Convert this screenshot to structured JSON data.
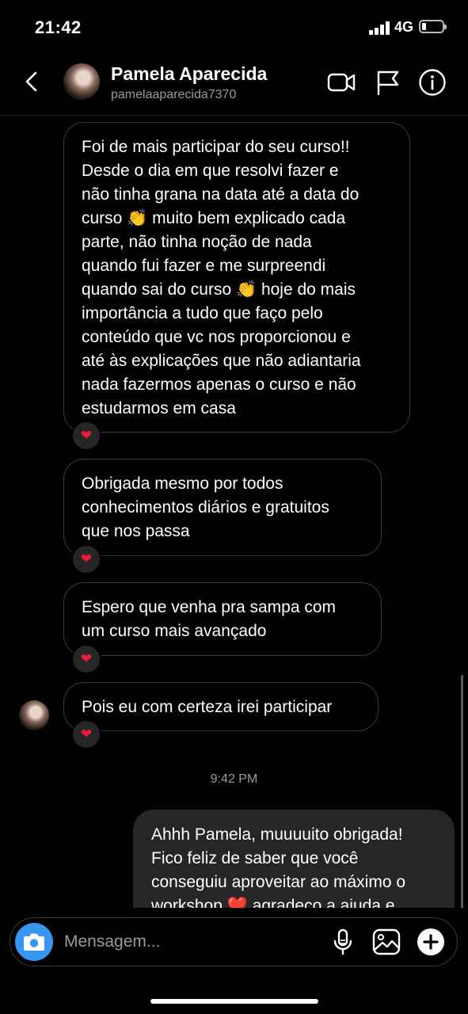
{
  "status_bar": {
    "time": "21:42",
    "network": "4G"
  },
  "header": {
    "name": "Pamela Aparecida",
    "username": "pamelaaparecida7370"
  },
  "messages": [
    {
      "text": "Foi de mais participar do seu curso!!\nDesde o dia em que resolvi fazer e\nnão tinha grana na data até a data do\ncurso 👏 muito bem explicado cada\nparte, não tinha noção de nada\nquando fui fazer e me surpreendi\nquando sai do curso 👏 hoje do mais\nimportância a tudo que faço pelo\nconteúdo que vc nos proporcionou e\naté às explicações que não adiantaria\nnada fazermos apenas o curso e não\nestudarmos em casa",
      "reaction": "❤"
    },
    {
      "text": "Obrigada mesmo por todos\nconhecimentos diários e gratuitos\nque nos passa",
      "reaction": "❤"
    },
    {
      "text": "Espero que venha pra sampa com\num curso mais avançado",
      "reaction": "❤"
    },
    {
      "text": "Pois eu com certeza irei participar",
      "reaction": "❤"
    },
    {
      "text": "Ahhh Pamela, muuuuito obrigada!\nFico feliz de saber que você\nconseguiu aproveitar ao máximo o\nworkshop ❤️ agradeço a ajuda e"
    }
  ],
  "timestamp": "9:42 PM",
  "composer": {
    "placeholder": "Mensagem..."
  },
  "icons": [
    "back-icon",
    "video-call-icon",
    "flag-icon",
    "info-icon",
    "camera-icon",
    "microphone-icon",
    "gallery-icon",
    "add-icon"
  ],
  "colors": {
    "background": "#000000",
    "camera_button": "#3797f0",
    "heart": "#ed1a3b",
    "outgoing_bubble": "#262626"
  }
}
